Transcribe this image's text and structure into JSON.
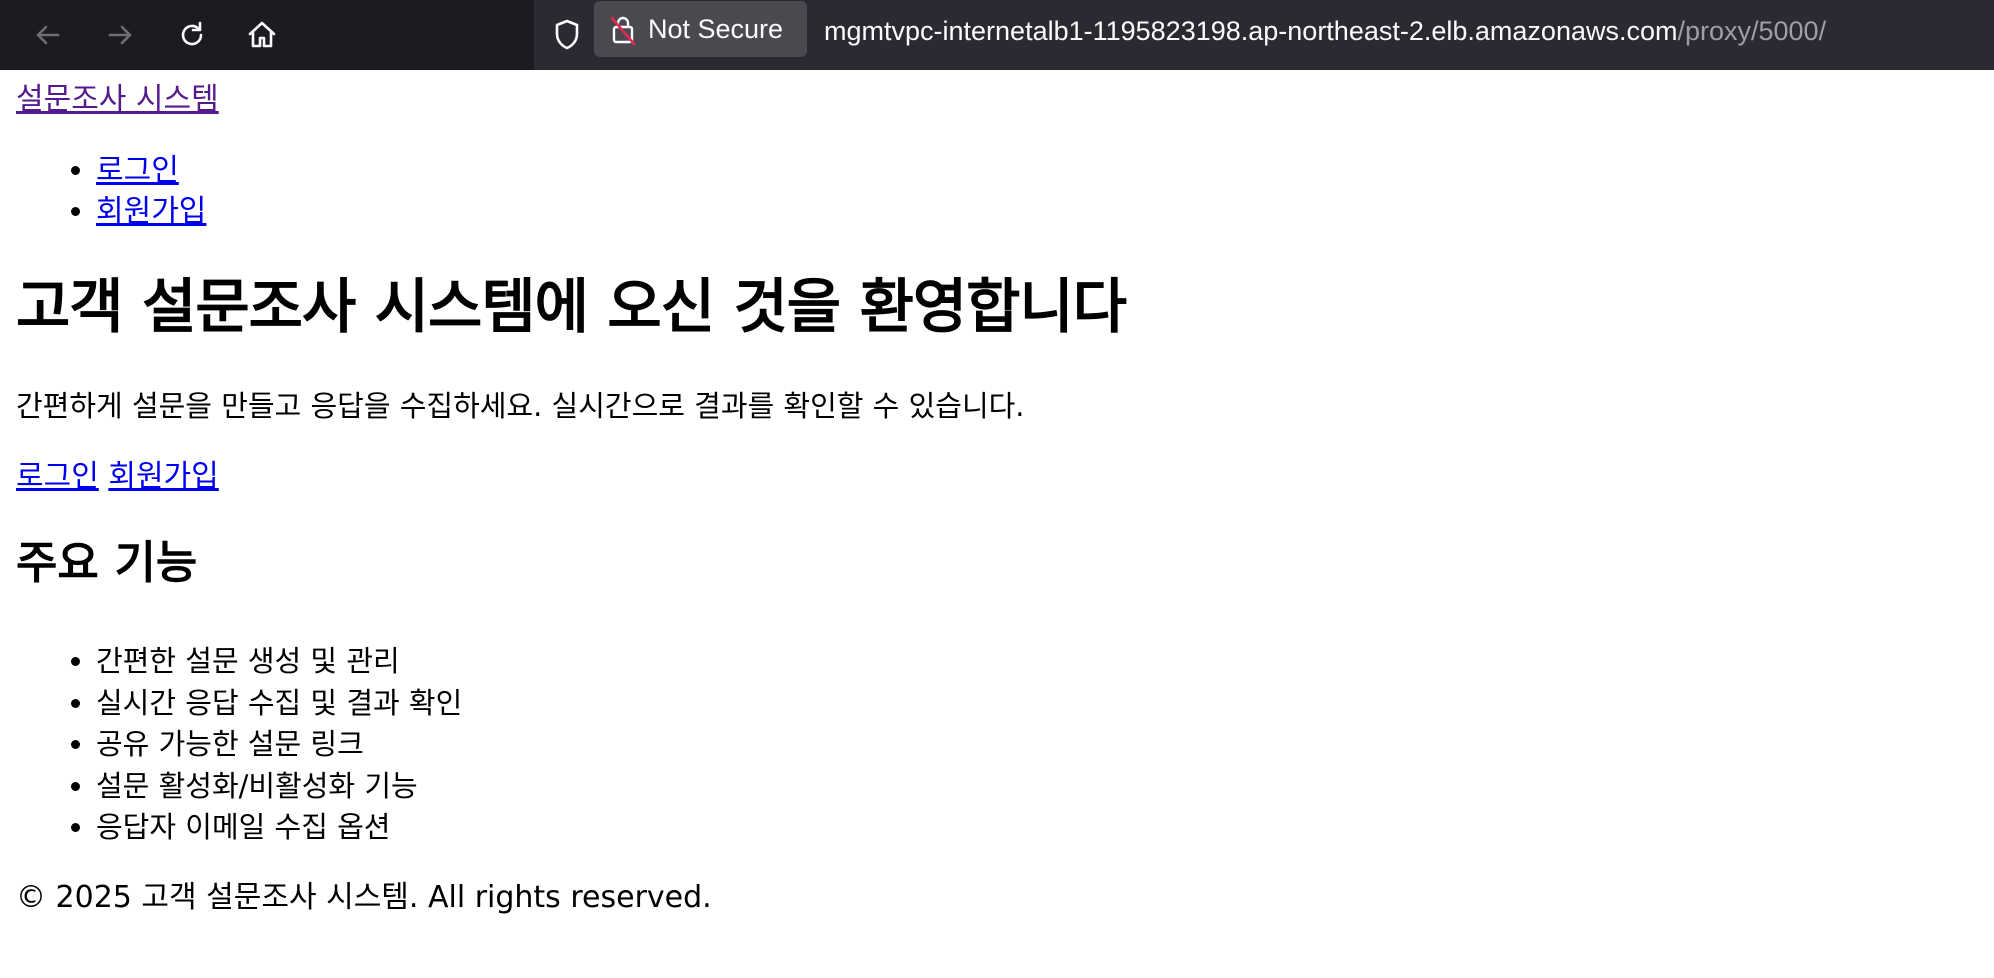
{
  "browser": {
    "back_icon": "arrow-left-icon",
    "forward_icon": "arrow-right-icon",
    "reload_icon": "reload-icon",
    "home_icon": "home-icon",
    "shield_icon": "shield-icon",
    "security_label": "Not Secure",
    "url_host": "mgmtvpc-internetalb1-1195823198.ap-northeast-2.elb.amazonaws.com",
    "url_path": "/proxy/5000/"
  },
  "header": {
    "brand": "설문조사 시스템",
    "nav": [
      {
        "label": "로그인"
      },
      {
        "label": "회원가입"
      }
    ]
  },
  "hero": {
    "title": "고객 설문조사 시스템에 오신 것을 환영합니다",
    "subtitle": "간편하게 설문을 만들고 응답을 수집하세요. 실시간으로 결과를 확인할 수 있습니다.",
    "login_link": "로그인",
    "signup_link": "회원가입"
  },
  "features": {
    "title": "주요 기능",
    "items": [
      "간편한 설문 생성 및 관리",
      "실시간 응답 수집 및 결과 확인",
      "공유 가능한 설문 링크",
      "설문 활성화/비활성화 기능",
      "응답자 이메일 수집 옵션"
    ]
  },
  "footer": {
    "text": "© 2025 고객 설문조사 시스템. All rights reserved."
  },
  "colors": {
    "toolbar_bg": "#1c1b22",
    "urlbar_bg": "#2b2a33",
    "link": "#0000ee",
    "visited_link": "#551a8b"
  }
}
